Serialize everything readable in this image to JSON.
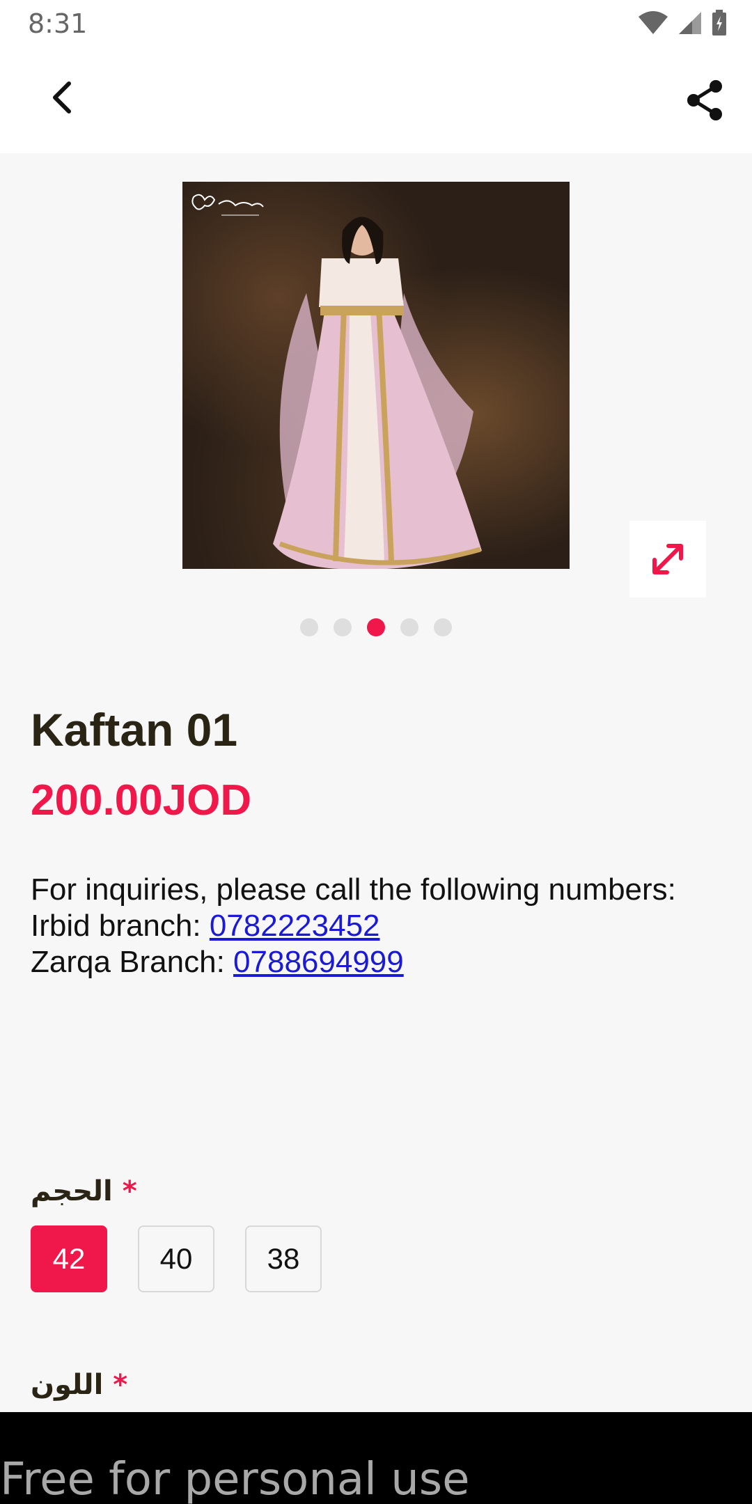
{
  "status_bar": {
    "time": "8:31",
    "icons": [
      "wifi-icon",
      "signal-icon",
      "battery-icon"
    ]
  },
  "app_bar": {
    "back_icon": "chevron-left-icon",
    "share_icon": "share-icon"
  },
  "gallery": {
    "image_count": 5,
    "active_index": 2,
    "expand_icon": "expand-icon",
    "watermark_text": "الفراشة البيضاء"
  },
  "product": {
    "title": "Kaftan 01",
    "price": "200.00JOD"
  },
  "description": {
    "line1": "For inquiries, please call the following numbers:",
    "irbid_label": "Irbid branch: ",
    "irbid_phone": "0782223452",
    "zarqa_label": "Zarqa Branch: ",
    "zarqa_phone": "0788694999"
  },
  "options": {
    "size_label": "الحجم",
    "required_mark": "*",
    "sizes": [
      "42",
      "40",
      "38"
    ],
    "selected_size": "42",
    "color_label": "اللون"
  },
  "banner": {
    "text": "Free for personal use"
  },
  "colors": {
    "accent": "#f0184a",
    "title": "#2a2414",
    "link": "#1a1ad6",
    "background": "#f7f7f7"
  }
}
